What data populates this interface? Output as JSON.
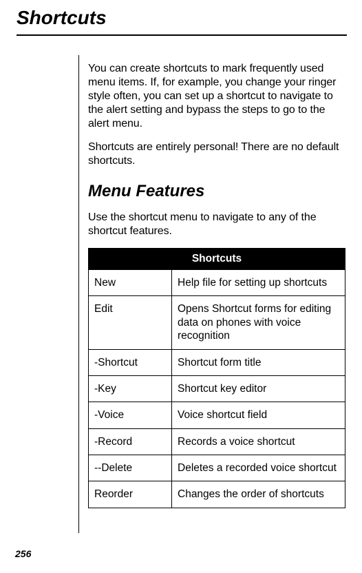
{
  "page": {
    "chapter_title": "Shortcuts",
    "page_number": "256"
  },
  "body": {
    "p1": "You can create shortcuts to mark frequently used menu items. If, for example, you change your ringer style often, you can set up a shortcut to navigate to the alert setting and bypass the steps to go to the alert menu.",
    "p2": "Shortcuts are entirely personal! There are no default shortcuts.",
    "section_title": "Menu Features",
    "p3": "Use the shortcut menu to navigate to any of the shortcut features."
  },
  "table": {
    "header": "Shortcuts",
    "rows": [
      {
        "name": "New",
        "desc": "Help file for setting up shortcuts"
      },
      {
        "name": "Edit",
        "desc": "Opens Shortcut forms for editing data on phones with voice recognition"
      },
      {
        "name": "-Shortcut",
        "desc": "Shortcut form title"
      },
      {
        "name": "-Key",
        "desc": "Shortcut key editor"
      },
      {
        "name": "-Voice",
        "desc": "Voice shortcut field"
      },
      {
        "name": "-Record",
        "desc": "Records a voice shortcut"
      },
      {
        "name": "--Delete",
        "desc": "Deletes a recorded voice shortcut"
      },
      {
        "name": "Reorder",
        "desc": "Changes the order of shortcuts"
      }
    ]
  }
}
